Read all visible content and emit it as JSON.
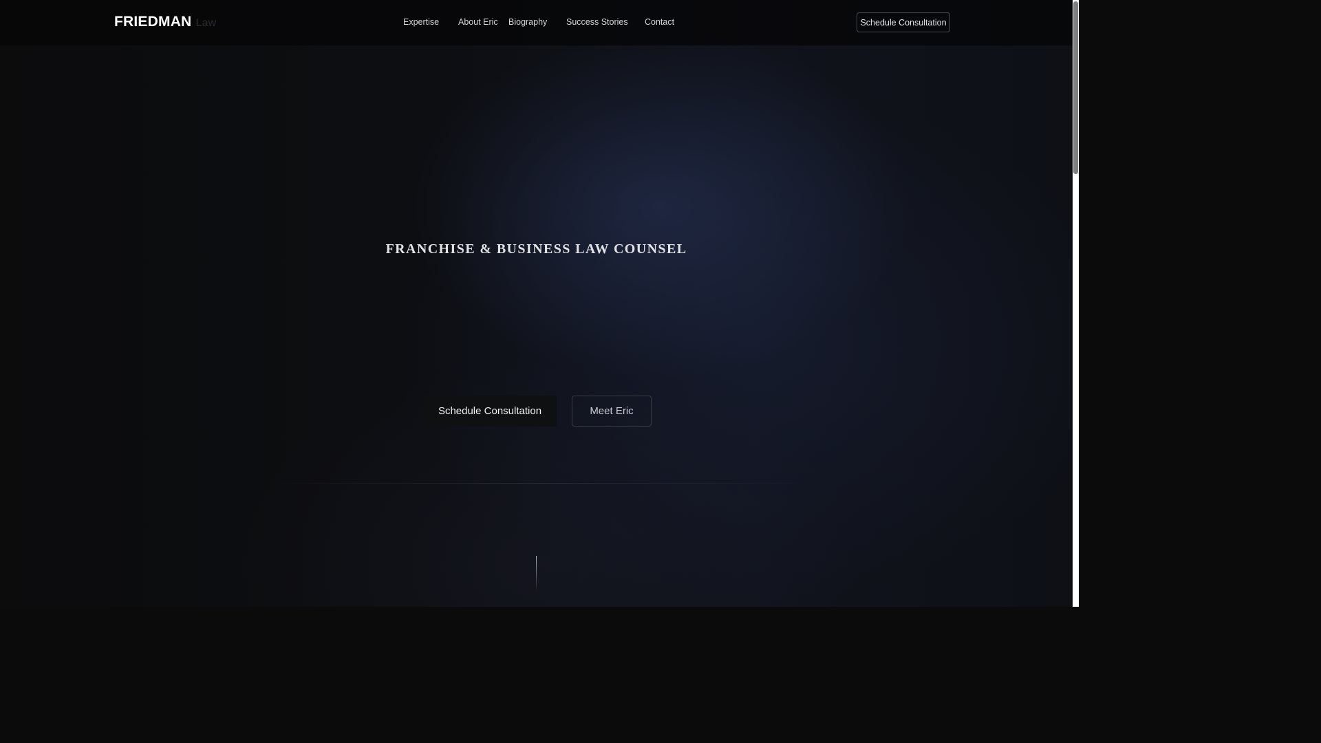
{
  "brand": {
    "name": "FRIEDMAN",
    "suffix": "Law"
  },
  "nav": {
    "items": [
      {
        "label": "Expertise"
      },
      {
        "label": "About Eric"
      },
      {
        "label": "Biography"
      },
      {
        "label": "Success Stories"
      },
      {
        "label": "Contact"
      }
    ],
    "cta_label": "Schedule Consultation"
  },
  "hero": {
    "title": "FRANCHISE & BUSINESS LAW COUNSEL",
    "primary_button": "Schedule Consultation",
    "secondary_button": "Meet Eric"
  },
  "theme": {
    "background": "#0b0b0c",
    "accent_blue": "#1c2440",
    "text": "#e3e3e6"
  },
  "scroll_indicator": {
    "icon": "scroll-down-line"
  }
}
